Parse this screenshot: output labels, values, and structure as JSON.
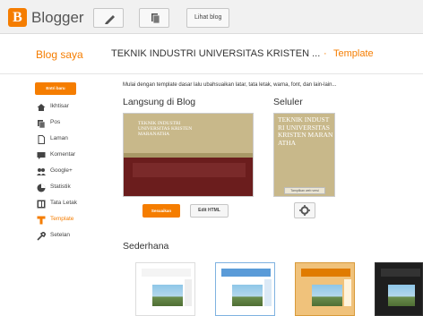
{
  "header": {
    "app_name": "Blogger",
    "logo_letter": "B",
    "view_blog_label": "Lihat blog"
  },
  "breadcrumb": {
    "root": "Blog saya",
    "blog_title": "TEKNIK INDUSTRI UNIVERSITAS KRISTEN ...",
    "separator": "·",
    "current": "Template"
  },
  "sidebar": {
    "new_post_label": "Entri baru",
    "items": [
      {
        "label": "Ikhtisar",
        "icon": "home-icon"
      },
      {
        "label": "Pos",
        "icon": "posts-icon"
      },
      {
        "label": "Laman",
        "icon": "pages-icon"
      },
      {
        "label": "Komentar",
        "icon": "comments-icon"
      },
      {
        "label": "Google+",
        "icon": "google-plus-icon"
      },
      {
        "label": "Statistik",
        "icon": "stats-icon"
      },
      {
        "label": "Tata Letak",
        "icon": "layout-icon"
      },
      {
        "label": "Template",
        "icon": "template-icon"
      },
      {
        "label": "Setelan",
        "icon": "settings-icon"
      }
    ]
  },
  "main": {
    "description": "Mulai dengan template dasar lalu ubahsuaikan latar, tata letak, warna, font, dan lain-lain...",
    "live_title": "Langsung di Blog",
    "mobile_title": "Seluler",
    "desktop_preview_title": "TEKNIK INDUSTRI UNIVERSITAS KRISTEN MARANATHA",
    "mobile_preview_title": "TEKNIK INDUSTRI UNIVERSITAS KRISTEN MARANATHA",
    "mobile_footer": "Tampilkan web versi",
    "customize_label": "Sesuaikan",
    "edit_html_label": "Edit HTML",
    "simple_title": "Sederhana"
  },
  "colors": {
    "accent": "#f57d00",
    "blog_header": "#c8b88a",
    "blog_body": "#6b1d1d"
  }
}
